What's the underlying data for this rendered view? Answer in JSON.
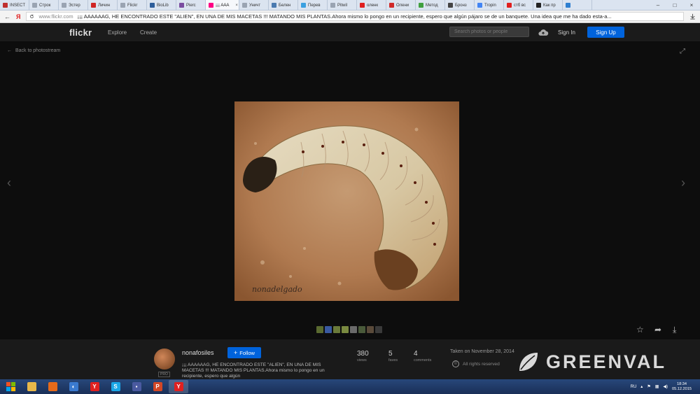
{
  "browser": {
    "tabs": [
      {
        "label": "INSECT",
        "icon": "photo-icon",
        "color": "#c03030"
      },
      {
        "label": "Строк",
        "icon": "page-icon",
        "color": "#9aa4b2"
      },
      {
        "label": "Эстер",
        "icon": "page-icon",
        "color": "#9aa4b2"
      },
      {
        "label": "Личин",
        "icon": "site-icon",
        "color": "#d02525"
      },
      {
        "label": "Flickr",
        "icon": "page-icon",
        "color": "#9aa4b2"
      },
      {
        "label": "BioLib",
        "icon": "site-icon",
        "color": "#2d5d9a"
      },
      {
        "label": "Pierc",
        "icon": "site-icon",
        "color": "#7a4ca0"
      },
      {
        "label": "¡¡¡ AAA",
        "icon": "flickr-icon",
        "color": "#ff0084"
      },
      {
        "label": "Уничт",
        "icon": "page-icon",
        "color": "#9aa4b2"
      },
      {
        "label": "Белен",
        "icon": "page-icon",
        "color": "#4a7ab0"
      },
      {
        "label": "Перев",
        "icon": "site-icon",
        "color": "#3aa0e0"
      },
      {
        "label": "Pitwil",
        "icon": "page-icon",
        "color": "#9aa4b2"
      },
      {
        "label": "оленк",
        "icon": "yandex-icon",
        "color": "#e02020"
      },
      {
        "label": "Олени",
        "icon": "site-icon",
        "color": "#d02a2a"
      },
      {
        "label": "Метод",
        "icon": "site-icon",
        "color": "#40a040"
      },
      {
        "label": "Бронз",
        "icon": "wiki-icon",
        "color": "#444444"
      },
      {
        "label": "Tropin",
        "icon": "google-icon",
        "color": "#4285f4"
      },
      {
        "label": "стб вс",
        "icon": "yandex-icon",
        "color": "#e02020"
      },
      {
        "label": "Как пр",
        "icon": "site-icon",
        "color": "#222222"
      },
      {
        "label": "",
        "icon": "site-icon",
        "color": "#2e7fd0"
      }
    ],
    "back_glyph": "←",
    "yandex_glyph": "Я",
    "address_host": "www.flickr.com",
    "address_title": "¡¡¡ AAAAAAG, HE ENCONTRADO ESTE \"ALIEN\", EN UNA DE MIS MACETAS !!! MATANDO MIS PLANTAS.Ahora mismo lo pongo en un recipiente, espero que algún pájaro se de un banquete. Una idea que me ha dado esta-a...",
    "address_icon": "refresh-icon"
  },
  "flickr": {
    "logo": "flickr",
    "nav": [
      "Explore",
      "Create"
    ],
    "search_placeholder": "Search photos or people",
    "sign_in": "Sign In",
    "sign_up": "Sign Up"
  },
  "viewer": {
    "back_label": "Back to photostream",
    "back_arrow": "←",
    "expand_glyph": "⤢",
    "prev_glyph": "‹",
    "next_glyph": "›",
    "photo_signature": "nonadelgado",
    "actions": {
      "fave": "☆",
      "share": "➦",
      "download": "⤓"
    },
    "filmstrip_colors": [
      "#5a6a30",
      "#3a5aa0",
      "#6a7a3a",
      "#7a8a40",
      "#6a6a6a",
      "#4a5a3a",
      "#5a4a3a",
      "#3a3a3a"
    ]
  },
  "info": {
    "username": "nonafosiles",
    "pro_badge": "PRO",
    "follow_label": "Follow",
    "follow_icon": "+",
    "description": "¡¡¡ AAAAAAG, HE ENCONTRADO ESTE \"ALIEN\", EN UNA DE MIS MACETAS !!! MATANDO MIS PLANTAS.Ahora mismo lo pongo en un recipiente, espero que algún",
    "stats": [
      {
        "value": "380",
        "label": "views"
      },
      {
        "value": "5",
        "label": "faves"
      },
      {
        "value": "4",
        "label": "comments"
      }
    ],
    "taken": "Taken on November 28, 2014",
    "rights_icon": "©",
    "rights": "All rights reserved"
  },
  "watermark": {
    "text": "GREENVAL"
  },
  "taskbar": {
    "apps": [
      {
        "icon": "folder-icon",
        "glyph": "",
        "color": "#e8b84a"
      },
      {
        "icon": "firefox-icon",
        "glyph": "",
        "color": "#e66a1a"
      },
      {
        "icon": "speaker-icon",
        "glyph": "◐",
        "color": "#3a7ad0"
      },
      {
        "icon": "yandex-browser-icon",
        "glyph": "Y",
        "color": "#e02020"
      },
      {
        "icon": "skype-icon",
        "glyph": "S",
        "color": "#1aa7e8"
      },
      {
        "icon": "save-icon",
        "glyph": "▪",
        "color": "#4a5aa0"
      },
      {
        "icon": "powerpoint-icon",
        "glyph": "P",
        "color": "#d24726"
      },
      {
        "icon": "yandex-browser-icon",
        "glyph": "Y",
        "color": "#e02020"
      }
    ],
    "lang": "RU",
    "time": "18:34",
    "date": "05.12.2015"
  }
}
